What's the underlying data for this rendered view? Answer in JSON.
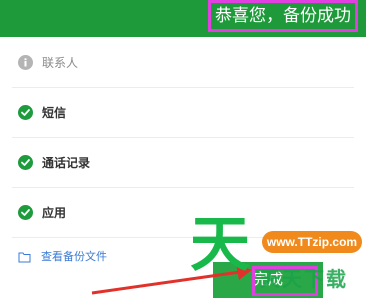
{
  "header": {
    "title": "恭喜您，备份成功"
  },
  "items": [
    {
      "label": "联系人",
      "status": "info",
      "icon": "info-icon"
    },
    {
      "label": "短信",
      "status": "done",
      "icon": "check-icon"
    },
    {
      "label": "通话记录",
      "status": "done",
      "icon": "check-icon"
    },
    {
      "label": "应用",
      "status": "done",
      "icon": "check-icon"
    }
  ],
  "footer": {
    "view_files_label": "查看备份文件",
    "view_files_icon": "folder-icon",
    "done_label": "完成"
  },
  "watermark": {
    "big_char": "天",
    "site": "www.TTzip.com",
    "tagline": "天天下载"
  },
  "colors": {
    "header_green": "#1f9a3a",
    "check_green": "#1e9b3d",
    "highlight_magenta": "#e040e0",
    "link_blue": "#3a7bd5",
    "arrow_red": "#e0322b"
  }
}
